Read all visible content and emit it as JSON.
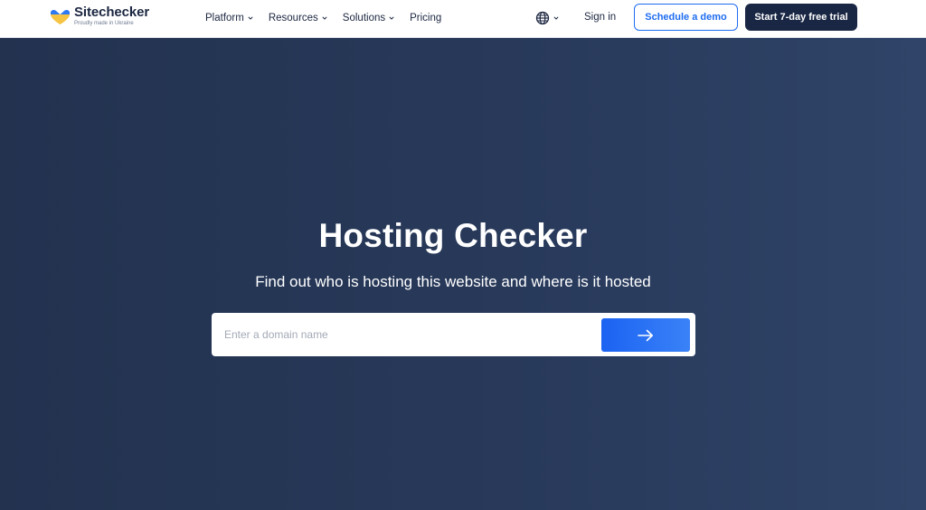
{
  "brand": {
    "name": "Sitechecker",
    "tagline": "Proudly made in Ukraine",
    "colors": {
      "flag_blue": "#2c79f2",
      "flag_yellow": "#f6c443"
    }
  },
  "nav": {
    "items": [
      {
        "label": "Platform",
        "has_dropdown": true
      },
      {
        "label": "Resources",
        "has_dropdown": true
      },
      {
        "label": "Solutions",
        "has_dropdown": true
      },
      {
        "label": "Pricing",
        "has_dropdown": false
      }
    ],
    "language_icon": "globe-icon",
    "sign_in": "Sign in",
    "schedule_demo": "Schedule a demo",
    "start_trial": "Start 7-day free trial"
  },
  "hero": {
    "title": "Hosting Checker",
    "subtitle": "Find out who is hosting this website and where is it hosted",
    "search": {
      "placeholder": "Enter a domain name",
      "value": "",
      "submit_icon": "arrow-right-icon"
    }
  },
  "colors": {
    "accent": "#1e6cf0",
    "dark_button": "#1a2744",
    "hero_bg_start": "#22324f",
    "hero_bg_end": "#2f4468"
  }
}
